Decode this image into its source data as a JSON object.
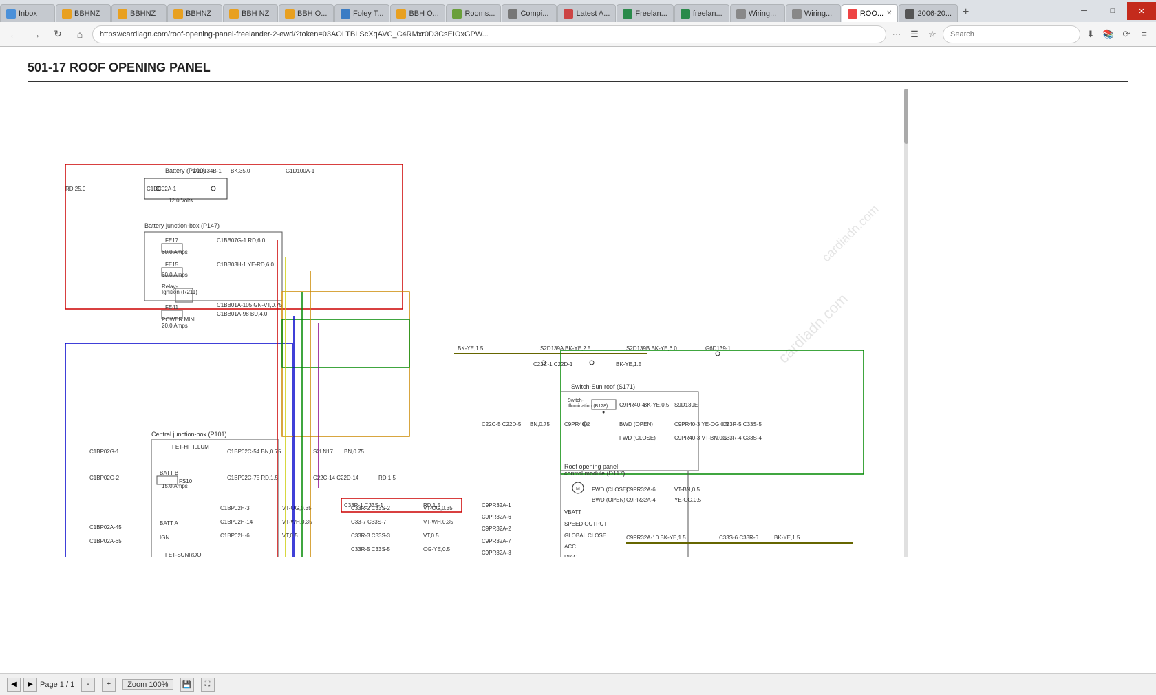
{
  "browser": {
    "title": "Roof Opening Panel - Freelander 2 EWD",
    "url": "https://cardiagn.com/roof-opening-panel-freelander-2-ewd/?token=03AOLTBLScXqAVC_C4RMxr0D3CsEIOxGPW...",
    "search_placeholder": "Search",
    "tabs": [
      {
        "id": "inbox",
        "label": "Inbox",
        "favicon_class": "fav-inbox",
        "active": false
      },
      {
        "id": "bbhnz1",
        "label": "BBHNZ",
        "favicon_class": "fav-bb",
        "active": false
      },
      {
        "id": "bbhnz2",
        "label": "BBHNZ",
        "favicon_class": "fav-bb",
        "active": false
      },
      {
        "id": "bbhnz3",
        "label": "BBHNZ",
        "favicon_class": "fav-bb",
        "active": false
      },
      {
        "id": "bbhNZ4",
        "label": "BBH NZ",
        "favicon_class": "fav-bb",
        "active": false
      },
      {
        "id": "bbhO5",
        "label": "BBH O...",
        "favicon_class": "fav-bb",
        "active": false
      },
      {
        "id": "foley",
        "label": "Foley T...",
        "favicon_class": "fav-foley",
        "active": false
      },
      {
        "id": "bbhO6",
        "label": "BBH O...",
        "favicon_class": "fav-bb",
        "active": false
      },
      {
        "id": "rooms",
        "label": "Rooms...",
        "favicon_class": "fav-room",
        "active": false
      },
      {
        "id": "compi",
        "label": "Compi...",
        "favicon_class": "fav-comp",
        "active": false
      },
      {
        "id": "latest",
        "label": "Latest A...",
        "favicon_class": "fav-latest",
        "active": false
      },
      {
        "id": "freel1",
        "label": "Freelan...",
        "favicon_class": "fav-free",
        "active": false
      },
      {
        "id": "freel2",
        "label": "freelan...",
        "favicon_class": "fav-free",
        "active": false
      },
      {
        "id": "wire1",
        "label": "Wiring...",
        "favicon_class": "fav-wire",
        "active": false
      },
      {
        "id": "wire2",
        "label": "Wiring...",
        "favicon_class": "fav-wire",
        "active": false
      },
      {
        "id": "roof",
        "label": "ROO...",
        "favicon_class": "fav-car",
        "active": true
      },
      {
        "id": "year",
        "label": "2006-20...",
        "favicon_class": "fav-year",
        "active": false
      }
    ],
    "window_controls": [
      {
        "id": "minimize",
        "label": "─"
      },
      {
        "id": "maximize",
        "label": "□"
      },
      {
        "id": "close",
        "label": "✕"
      }
    ]
  },
  "page": {
    "title": "501-17 ROOF OPENING PANEL",
    "watermark": "cardiadn.com"
  },
  "status_bar": {
    "page_label": "Page",
    "page_current": "1",
    "page_total": "1",
    "zoom_label": "Zoom 100%"
  }
}
